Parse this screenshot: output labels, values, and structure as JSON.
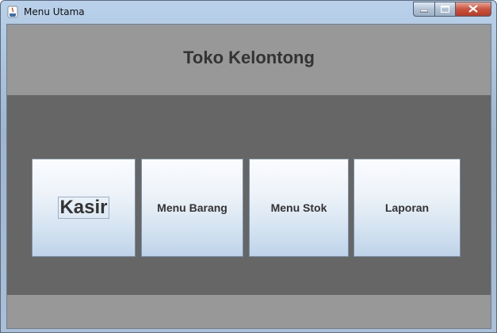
{
  "window": {
    "title": "Menu Utama"
  },
  "header": {
    "title": "Toko Kelontong"
  },
  "menu": {
    "kasir": "Kasir",
    "barang": "Menu Barang",
    "stok": "Menu Stok",
    "laporan": "Laporan"
  },
  "icons": {
    "app": "java-icon",
    "minimize": "minimize-icon",
    "maximize": "maximize-icon",
    "close": "close-icon"
  }
}
